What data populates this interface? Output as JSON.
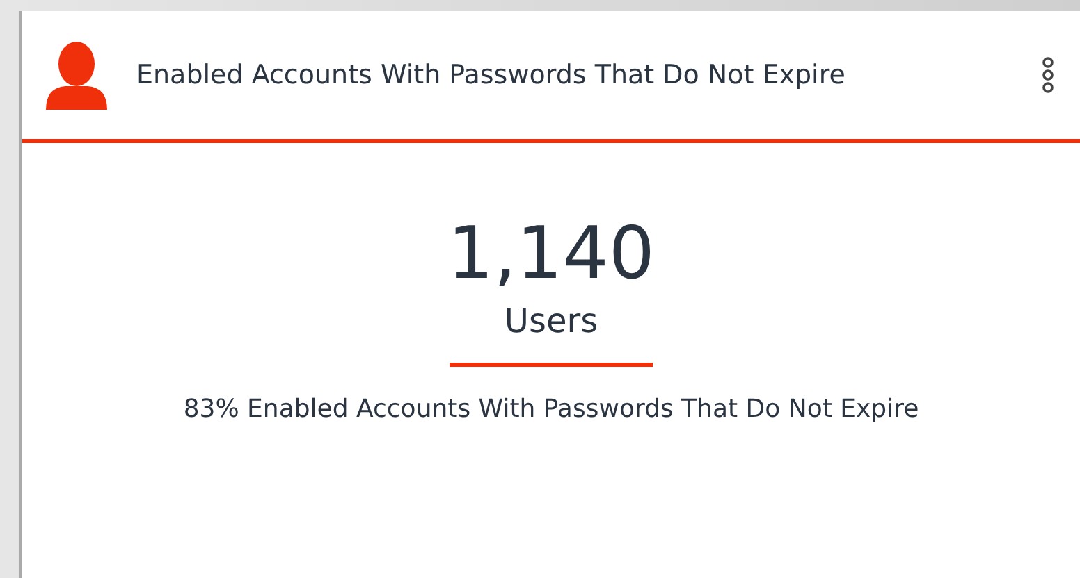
{
  "card": {
    "title": "Enabled Accounts With Passwords That Do Not Expire",
    "value": "1,140",
    "unit": "Users",
    "description": "83% Enabled Accounts With Passwords That Do Not Expire"
  }
}
